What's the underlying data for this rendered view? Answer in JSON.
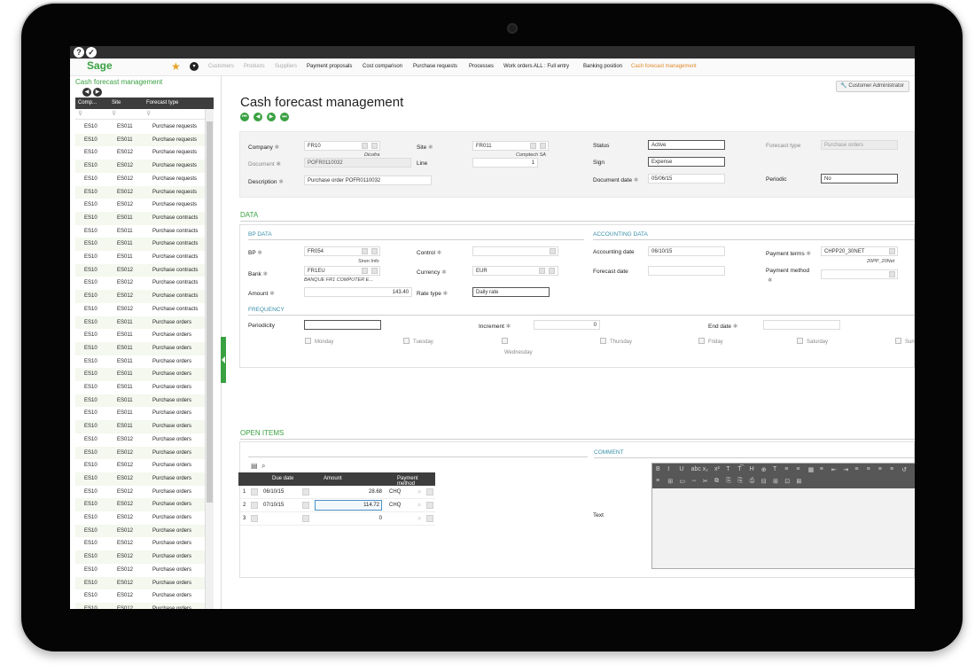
{
  "topbar": {
    "help_icon": "?",
    "check_icon": "✓"
  },
  "nav": {
    "logo": "Sage",
    "star_icon": "★",
    "menu_icon": "▾",
    "links": [
      {
        "label": "Customers",
        "state": "muted"
      },
      {
        "label": "Products",
        "state": "muted"
      },
      {
        "label": "Suppliers",
        "state": "muted"
      },
      {
        "label": "Payment proposals",
        "state": "normal"
      },
      {
        "label": "Cost comparison",
        "state": "normal"
      },
      {
        "label": "Purchase requests",
        "state": "normal"
      },
      {
        "label": "Processes",
        "state": "normal"
      },
      {
        "label": "Work orders ALL : Full entry",
        "state": "normal"
      },
      {
        "label": "Banking position",
        "state": "normal"
      },
      {
        "label": "Cash forecast management",
        "state": "active"
      }
    ]
  },
  "left_panel": {
    "title": "Cash forecast management",
    "columns": [
      "Comp...",
      "Site",
      "Forecast type"
    ],
    "rows": [
      [
        "ES10",
        "ES011",
        "Purchase requests"
      ],
      [
        "ES10",
        "ES011",
        "Purchase requests"
      ],
      [
        "ES10",
        "ES012",
        "Purchase requests"
      ],
      [
        "ES10",
        "ES012",
        "Purchase requests"
      ],
      [
        "ES10",
        "ES012",
        "Purchase requests"
      ],
      [
        "ES10",
        "ES012",
        "Purchase requests"
      ],
      [
        "ES10",
        "ES012",
        "Purchase requests"
      ],
      [
        "ES10",
        "ES011",
        "Purchase contracts"
      ],
      [
        "ES10",
        "ES011",
        "Purchase contracts"
      ],
      [
        "ES10",
        "ES011",
        "Purchase contracts"
      ],
      [
        "ES10",
        "ES011",
        "Purchase contracts"
      ],
      [
        "ES10",
        "ES012",
        "Purchase contracts"
      ],
      [
        "ES10",
        "ES012",
        "Purchase contracts"
      ],
      [
        "ES10",
        "ES012",
        "Purchase contracts"
      ],
      [
        "ES10",
        "ES012",
        "Purchase contracts"
      ],
      [
        "ES10",
        "ES011",
        "Purchase orders"
      ],
      [
        "ES10",
        "ES011",
        "Purchase orders"
      ],
      [
        "ES10",
        "ES011",
        "Purchase orders"
      ],
      [
        "ES10",
        "ES011",
        "Purchase orders"
      ],
      [
        "ES10",
        "ES011",
        "Purchase orders"
      ],
      [
        "ES10",
        "ES011",
        "Purchase orders"
      ],
      [
        "ES10",
        "ES011",
        "Purchase orders"
      ],
      [
        "ES10",
        "ES011",
        "Purchase orders"
      ],
      [
        "ES10",
        "ES011",
        "Purchase orders"
      ],
      [
        "ES10",
        "ES012",
        "Purchase orders"
      ],
      [
        "ES10",
        "ES012",
        "Purchase orders"
      ],
      [
        "ES10",
        "ES012",
        "Purchase orders"
      ],
      [
        "ES10",
        "ES012",
        "Purchase orders"
      ],
      [
        "ES10",
        "ES012",
        "Purchase orders"
      ],
      [
        "ES10",
        "ES012",
        "Purchase orders"
      ],
      [
        "ES10",
        "ES012",
        "Purchase orders"
      ],
      [
        "ES10",
        "ES012",
        "Purchase orders"
      ],
      [
        "ES10",
        "ES012",
        "Purchase orders"
      ],
      [
        "ES10",
        "ES012",
        "Purchase orders"
      ],
      [
        "ES10",
        "ES012",
        "Purchase orders"
      ],
      [
        "ES10",
        "ES012",
        "Purchase orders"
      ],
      [
        "ES10",
        "ES012",
        "Purchase orders"
      ],
      [
        "ES10",
        "ES012",
        "Purchase orders"
      ]
    ]
  },
  "user_button": "Customer Administrator",
  "page_title": "Cash forecast management",
  "header": {
    "company_label": "Company",
    "company_value": "FR10",
    "company_desc": "Dicofra",
    "site_label": "Site",
    "site_value": "FR011",
    "site_desc": "Comptech SA",
    "status_label": "Status",
    "status_value": "Active",
    "forecast_type_label": "Forecast type",
    "forecast_type_value": "Purchase orders",
    "document_label": "Document",
    "document_value": "POFR0110032",
    "line_label": "Line",
    "line_value": "1",
    "sign_label": "Sign",
    "sign_value": "Expense",
    "description_label": "Description",
    "description_value": "Purchase order POFR0110032",
    "document_date_label": "Document date",
    "document_date_value": "05/06/15",
    "periodic_label": "Periodic",
    "periodic_value": "No"
  },
  "data_section": {
    "title": "DATA",
    "bp_data_title": "BP DATA",
    "accounting_title": "ACCOUNTING DATA",
    "bp_label": "BP",
    "bp_value": "FR054",
    "bp_desc": "Siren Info",
    "control_label": "Control",
    "control_value": "",
    "accounting_date_label": "Accounting date",
    "accounting_date_value": "06/10/15",
    "payment_terms_label": "Payment terms",
    "payment_terms_value": "CHPP20_30NET",
    "payment_terms_desc": "20PP_20Net",
    "bank_label": "Bank",
    "bank_value": "FR1EU",
    "bank_desc": "BANQUE FR1 COMPUTER E...",
    "currency_label": "Currency",
    "currency_value": "EUR",
    "forecast_date_label": "Forecast date",
    "forecast_date_value": "",
    "payment_method_label": "Payment method",
    "payment_method_value": "",
    "amount_label": "Amount",
    "amount_value": "143.40",
    "rate_type_label": "Rate type",
    "rate_type_value": "Daily rate",
    "frequency_title": "FREQUENCY",
    "periodicity_label": "Periodicity",
    "periodicity_value": "",
    "increment_label": "Increment",
    "increment_value": "0",
    "end_date_label": "End date",
    "end_date_value": "",
    "days": [
      "Monday",
      "Tuesday",
      "Wednesday",
      "Thursday",
      "Friday",
      "Saturday",
      "Sun"
    ]
  },
  "open_items": {
    "title": "OPEN ITEMS",
    "columns": [
      "Due date",
      "Amount",
      "Payment method"
    ],
    "rows": [
      {
        "num": "1",
        "due_date": "06/10/15",
        "amount": "28.68",
        "method": "CHQ"
      },
      {
        "num": "2",
        "due_date": "07/10/15",
        "amount": "114.72",
        "method": "CHQ"
      },
      {
        "num": "3",
        "due_date": "",
        "amount": "0",
        "method": ""
      }
    ]
  },
  "comment": {
    "title": "COMMENT",
    "text_label": "Text",
    "toolbar_row1": [
      "B",
      "I",
      "U",
      "abc",
      "x₂",
      "x²",
      "T",
      "T͡",
      "H",
      "⊕",
      "T",
      "≡",
      "≡",
      "▦",
      "≡",
      "⇤",
      "⇥",
      "≡",
      "≡",
      "≡",
      "≡",
      "↺"
    ],
    "toolbar_row2": [
      "≡",
      "⊞",
      "▭",
      "⇔",
      "✂",
      "⧉",
      "⎘",
      "⎘",
      "⎙",
      "⊟",
      "⊞",
      "⊡",
      "⊠"
    ]
  }
}
